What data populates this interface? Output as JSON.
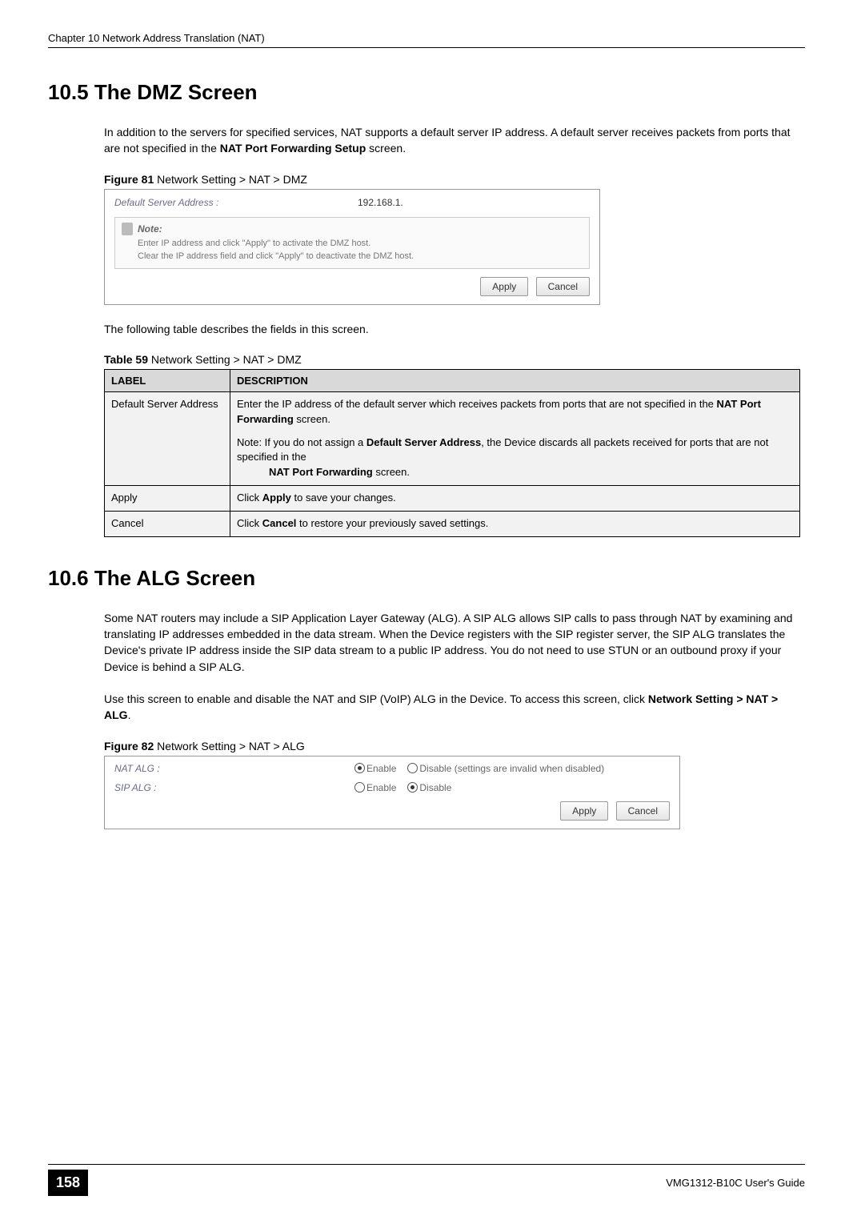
{
  "header": {
    "chapter": "Chapter 10 Network Address Translation (NAT)"
  },
  "section105": {
    "heading": "10.5  The DMZ Screen",
    "para": "In addition to the servers for specified services, NAT supports a default server IP address. A default server receives packets from ports that are not specified in the ",
    "para_bold": "NAT Port Forwarding Setup",
    "para_end": " screen.",
    "figure_caption_bold": "Figure 81",
    "figure_caption_rest": "   Network Setting > NAT > DMZ",
    "after_figure": "The following table describes the fields in this screen.",
    "table_caption_bold": "Table 59",
    "table_caption_rest": "   Network Setting > NAT > DMZ"
  },
  "fig81": {
    "label": "Default Server Address :",
    "value": "192.168.1.",
    "note_title": "Note:",
    "note_line1": "Enter IP address and click \"Apply\" to activate the DMZ host.",
    "note_line2": "Clear the IP address field and click \"Apply\" to deactivate the DMZ host.",
    "apply": "Apply",
    "cancel": "Cancel"
  },
  "table59": {
    "col1": "LABEL",
    "col2": "DESCRIPTION",
    "rows": [
      {
        "label": "Default Server Address",
        "desc_pre": "Enter the IP address of the default server which receives packets from ports that are not specified in the ",
        "desc_bold": "NAT Port Forwarding",
        "desc_post": " screen.",
        "note_pre": "Note: If you do not assign a ",
        "note_b1": "Default Server Address",
        "note_mid": ", the Device discards all packets received for ports that are not specified in the ",
        "note_b2": "NAT Port Forwarding",
        "note_end": " screen."
      },
      {
        "label": "Apply",
        "desc_pre": "Click ",
        "desc_bold": "Apply",
        "desc_post": " to save your changes."
      },
      {
        "label": "Cancel",
        "desc_pre": "Click ",
        "desc_bold": "Cancel",
        "desc_post": " to restore your previously saved settings."
      }
    ]
  },
  "section106": {
    "heading": "10.6  The ALG Screen",
    "para1": "Some NAT routers may include a SIP Application Layer Gateway (ALG). A SIP ALG allows SIP calls to pass through NAT by examining and translating IP addresses embedded in the data stream. When the Device registers with the SIP register server, the SIP ALG translates the Device's private IP address inside the SIP data stream to a public IP address. You do not need to use STUN or an outbound proxy if your Device is behind a SIP ALG.",
    "para2_pre": "Use this screen to enable and disable the NAT and SIP (VoIP) ALG in the Device. To access this screen, click ",
    "para2_bold": "Network Setting > NAT > ALG",
    "para2_end": ".",
    "figure_caption_bold": "Figure 82",
    "figure_caption_rest": "   Network Setting > NAT > ALG"
  },
  "fig82": {
    "row1_label": "NAT ALG :",
    "row2_label": "SIP ALG :",
    "enable": "Enable",
    "disable": "Disable",
    "disable_extra": "Disable (settings are invalid when disabled)",
    "apply": "Apply",
    "cancel": "Cancel"
  },
  "footer": {
    "page": "158",
    "guide": "VMG1312-B10C User's Guide"
  }
}
